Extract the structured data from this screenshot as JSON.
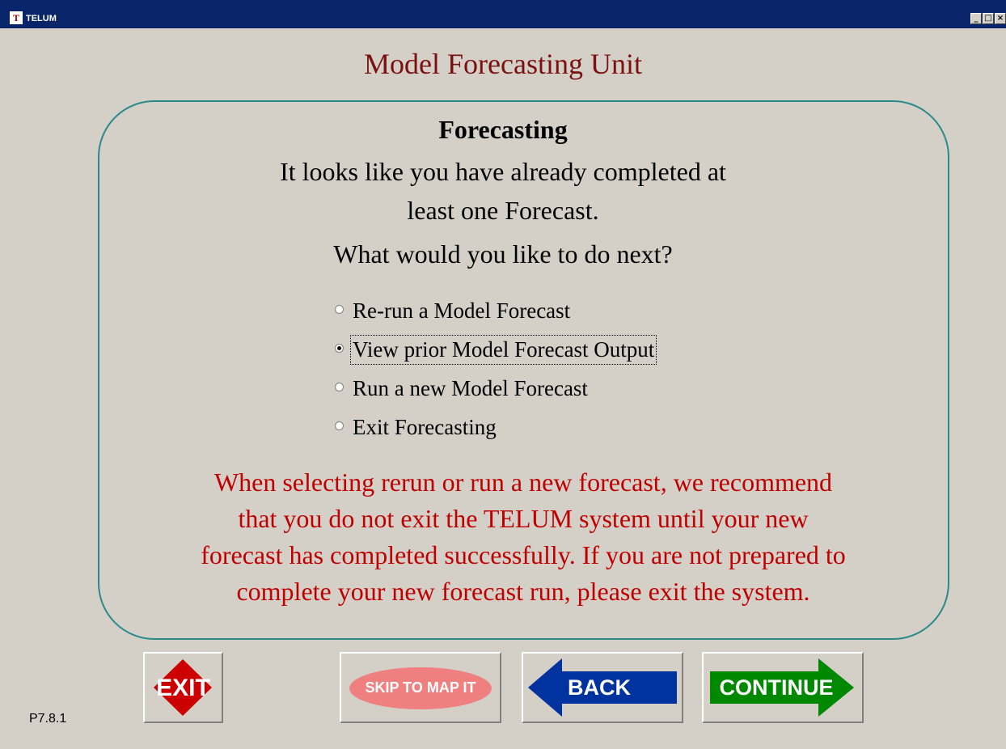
{
  "window": {
    "title": "TELUM",
    "icon": "telum-logo-icon",
    "controls": [
      "minimize",
      "maximize",
      "close"
    ]
  },
  "page": {
    "title": "Model Forecasting Unit",
    "heading": "Forecasting",
    "intro_line1": "It looks like you have already completed at",
    "intro_line2": "least one Forecast.",
    "question": "What would you like to do next?",
    "options": [
      {
        "label": "Re-run a Model Forecast",
        "selected": false
      },
      {
        "label": "View prior Model Forecast Output",
        "selected": true
      },
      {
        "label": "Run a new Model Forecast",
        "selected": false
      },
      {
        "label": "Exit Forecasting",
        "selected": false
      }
    ],
    "warning_lines": [
      "When selecting rerun or run a new forecast, we recommend",
      "that you do not exit the TELUM system until your new",
      "forecast has completed successfully. If you are not prepared to",
      "complete your new forecast run, please exit the system."
    ],
    "page_code": "P7.8.1"
  },
  "buttons": {
    "exit": "EXIT",
    "skip": "SKIP TO MAP IT",
    "back": "BACK",
    "continue": "CONTINUE"
  },
  "colors": {
    "title": "#7b1010",
    "panel_border": "#2a8a8a",
    "warning": "#c00000",
    "exit": "#cc0000",
    "skip": "#f08080",
    "back": "#0033a0",
    "continue": "#008800"
  }
}
